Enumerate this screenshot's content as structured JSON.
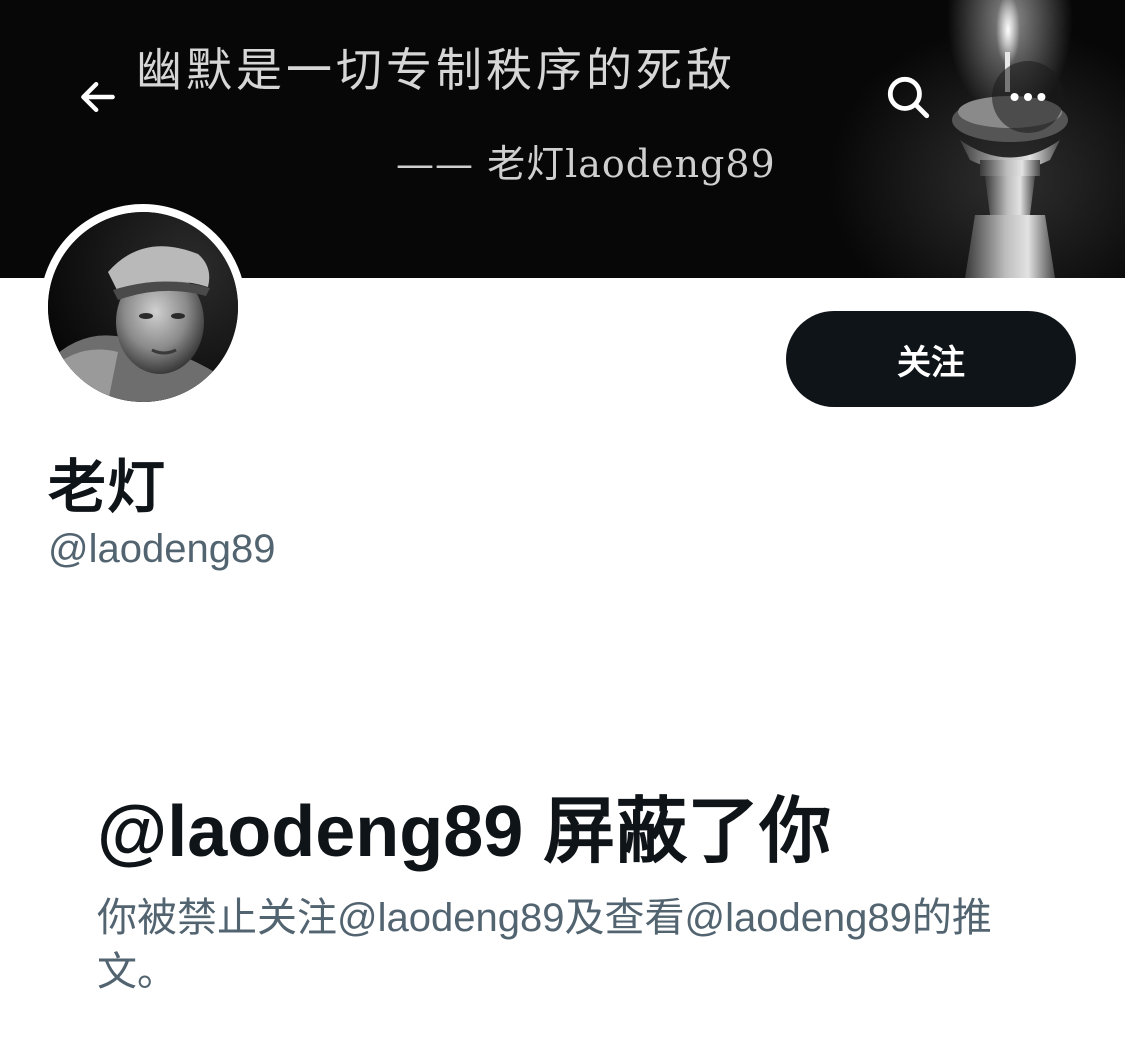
{
  "header": {
    "banner_quote": "幽默是一切专制秩序的死敌",
    "banner_signature": "—— 老灯laodeng89",
    "back_icon": "arrow-left-icon",
    "search_icon": "search-icon",
    "more_icon": "more-horizontal-icon"
  },
  "profile": {
    "display_name": "老灯",
    "handle": "@laodeng89",
    "follow_label": "关注"
  },
  "blocked_notice": {
    "title": "@laodeng89 屏蔽了你",
    "description": "你被禁止关注@laodeng89及查看@laodeng89的推文。"
  },
  "colors": {
    "primary_text": "#0f1419",
    "secondary_text": "#536471",
    "button_bg": "#0f1419",
    "button_text": "#ffffff",
    "banner_bg": "#070707"
  }
}
